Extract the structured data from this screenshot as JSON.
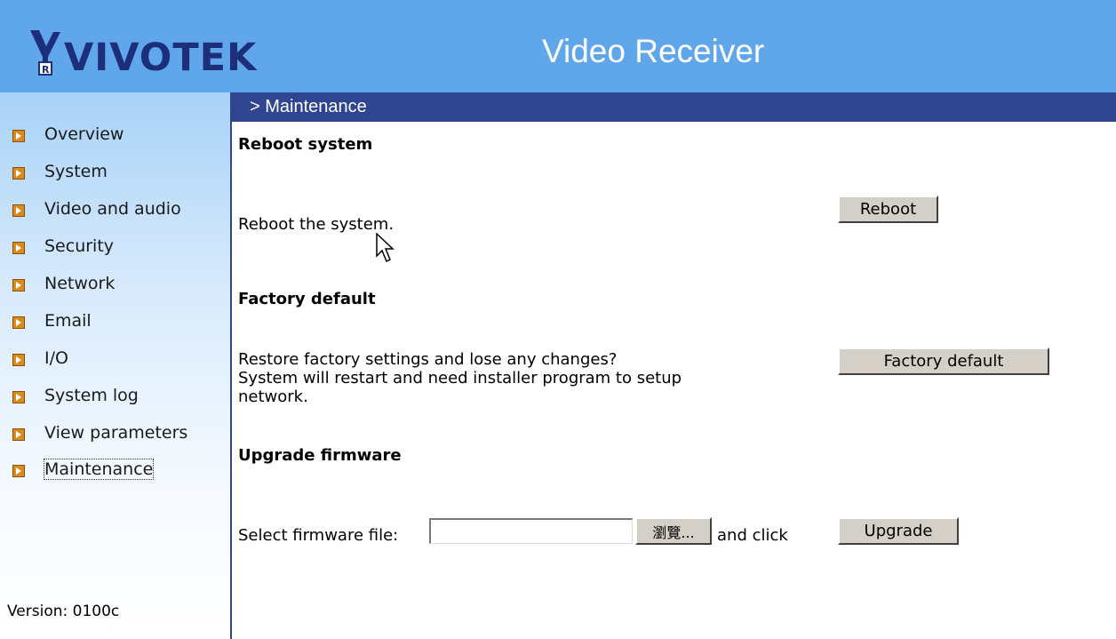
{
  "header": {
    "logo_text": "VIVOTEK",
    "title": "Video Receiver"
  },
  "sidebar": {
    "items": [
      {
        "label": "Overview",
        "icon": "arrow-right-icon"
      },
      {
        "label": "System",
        "icon": "arrow-right-icon"
      },
      {
        "label": "Video and audio",
        "icon": "arrow-right-icon"
      },
      {
        "label": "Security",
        "icon": "arrow-right-icon"
      },
      {
        "label": "Network",
        "icon": "arrow-right-icon"
      },
      {
        "label": "Email",
        "icon": "arrow-right-icon"
      },
      {
        "label": "I/O",
        "icon": "arrow-right-icon"
      },
      {
        "label": "System log",
        "icon": "arrow-right-icon"
      },
      {
        "label": "View parameters",
        "icon": "arrow-right-icon"
      },
      {
        "label": "Maintenance",
        "icon": "arrow-right-icon",
        "active": true
      }
    ],
    "version": "Version: 0100c"
  },
  "breadcrumb": "> Maintenance",
  "sections": {
    "reboot": {
      "title": "Reboot system",
      "description": "Reboot the system.",
      "button": "Reboot"
    },
    "factory": {
      "title": "Factory default",
      "description_line1": "Restore factory settings and lose any changes?",
      "description_line2": "System will restart and need installer program to setup",
      "description_line3": "network.",
      "button": "Factory default"
    },
    "upgrade": {
      "title": "Upgrade firmware",
      "select_label": "Select firmware file:",
      "file_value": "",
      "browse_button": "瀏覽...",
      "and_click": "and click",
      "button": "Upgrade"
    }
  },
  "colors": {
    "header_bg": "#5fa6ea",
    "nav_bar": "#2f4592",
    "logo": "#1d2f7a"
  }
}
